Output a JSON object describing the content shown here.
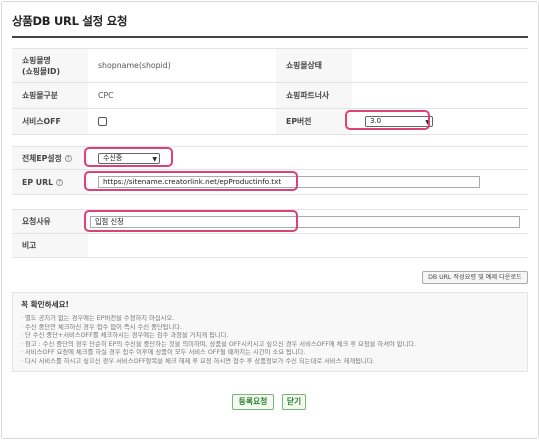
{
  "page": {
    "title": "상품DB URL 설정 요청"
  },
  "shop_info": {
    "mall_name_label": "쇼핑몰명\n(쇼핑몰ID)",
    "mall_name_value": "shopname(shopid)",
    "mall_status_label": "쇼핑몰상태",
    "mall_status_value": "",
    "mall_type_label": "쇼핑몰구분",
    "mall_type_value": "CPC",
    "partner_label": "쇼핑파트너사",
    "partner_value": "",
    "service_off_label": "서비스OFF",
    "service_off_checked": false,
    "ep_version_label": "EP버전",
    "ep_version_value": "3.0"
  },
  "ep_settings": {
    "global_ep_label": "전체EP설정",
    "global_ep_value": "수신중",
    "ep_url_label": "EP URL",
    "ep_url_value": "https://sitename.creatorlink.net/epProductinfo.txt"
  },
  "request": {
    "reason_label": "요청사유",
    "reason_value": "입점 신청",
    "note_label": "비고",
    "note_value": ""
  },
  "guide_button": {
    "label": "DB URL 작성요령 및 예제 다운로드"
  },
  "notice": {
    "title": "꼭 확인하세요!",
    "items": [
      "별도 공지가 없는 경우에는 EP버전을 수정하지 마십시오.",
      "수신 중단만 체크하신 경우 접수 없이 즉시 수신 중단됩니다.",
      "단 수신 중단+서비스OFF를 체크하시는 경우에는 검수 과정을 거치게 됩니다.",
      "참고 : 수신 중단의 경우 단순히 EP의 수신을 중단하는 것을 의미하며, 상품을 OFF시키시고 싶으신 경우 서비스OFF에 체크 후 요청을 하셔야 합니다.",
      "서비스OFF 요청에 체크를 하실 경우 접수 이후에 상품이 모두 서비스 OFF될 때까지는 시간이 소요 됩니다.",
      "다시 서비스를 하시고 싶으신 경우 서비스OFF항목을 체크 해제 후 요청 하시면 접수 후 상품정보가 수신 되는대로 서비스 재개됩니다."
    ]
  },
  "actions": {
    "submit_label": "등록요청",
    "close_label": "닫기"
  },
  "colors": {
    "highlight": "#d9437a",
    "button_green": "#2d7a2d"
  }
}
